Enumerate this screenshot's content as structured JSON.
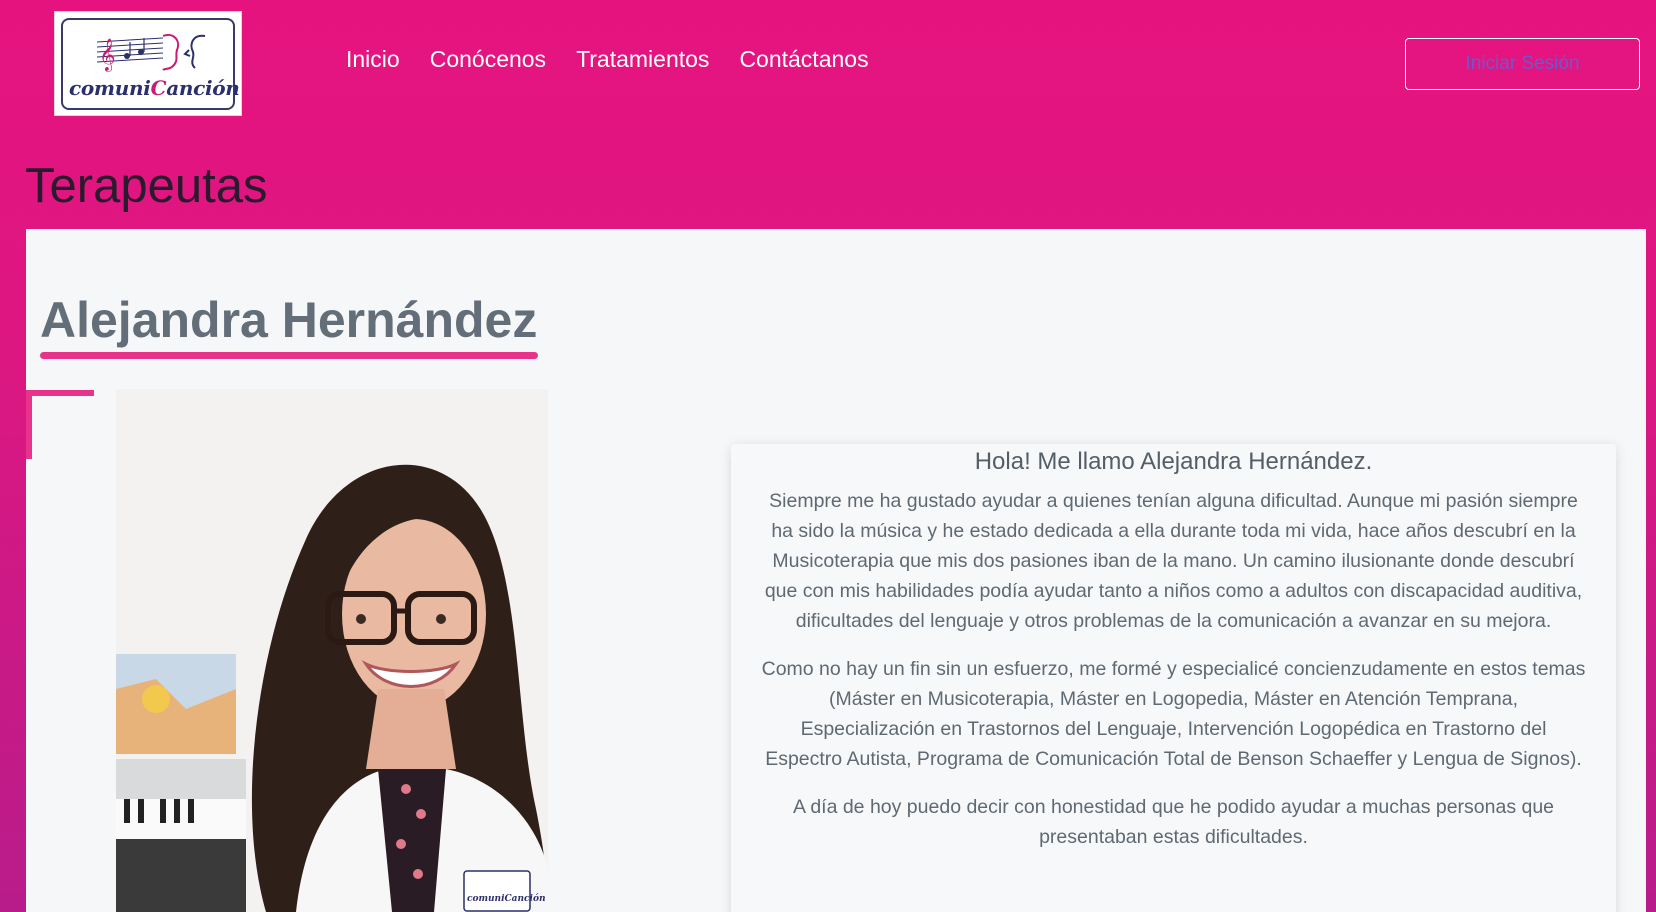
{
  "header": {
    "logo_text": "comuniCanción",
    "nav": [
      "Inicio",
      "Conócenos",
      "Tratamientos",
      "Contáctanos"
    ],
    "login_label": "Iniciar Sesión"
  },
  "section_title": "Terapeutas",
  "therapist": {
    "name": "Alejandra Hernández",
    "badge_text": "comuniCanción",
    "greeting": "Hola! Me llamo Alejandra Hernández.",
    "paragraphs": [
      "Siempre me ha gustado ayudar a quienes tenían alguna dificultad. Aunque mi pasión siempre ha sido la música y he estado dedicada a ella durante toda mi vida, hace años descubrí en la Musicoterapia que mis dos pasiones iban de la mano. Un camino ilusionante donde descubrí que con mis habilidades podía ayudar tanto a niños como a adultos con discapacidad auditiva, dificultades del lenguaje y otros problemas de la comunicación a avanzar en su mejora.",
      "Como no hay un fin sin un esfuerzo, me formé y especialicé concienzudamente en estos temas (Máster en Musicoterapia, Máster en Logopedia, Máster en Atención Temprana, Especialización en Trastornos del Lenguaje, Intervención Logopédica en Trastorno del Espectro Autista, Programa de Comunicación Total de Benson Schaeffer y Lengua de Signos).",
      "A día de hoy puedo decir con honestidad que he podido ayudar a muchas personas que presentaban estas dificultades."
    ]
  },
  "colors": {
    "brand_pink": "#e6137f",
    "accent_pink": "#e8338a",
    "panel_bg": "#f6f7f9",
    "logo_navy": "#2b2f6b"
  }
}
